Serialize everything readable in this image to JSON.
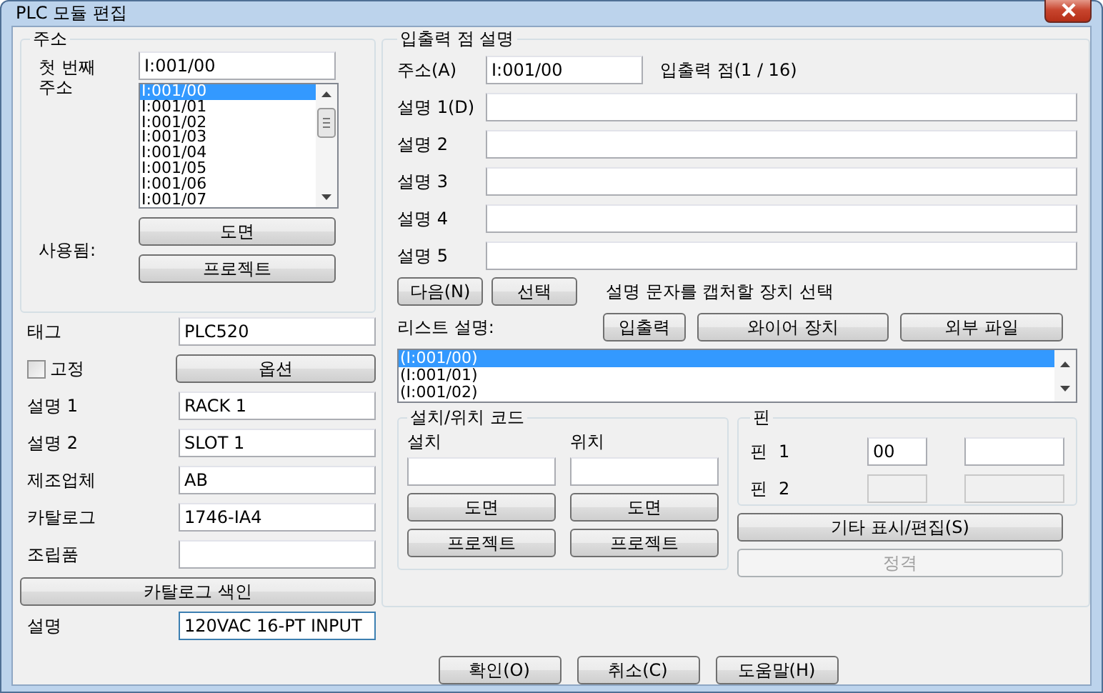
{
  "window": {
    "title": "PLC 모듈 편집"
  },
  "address_group": {
    "title": "주소",
    "first_address_label": "첫 번째 주소",
    "first_address": "I:001/00",
    "used_label": "사용됨:",
    "buttons": [
      "도면",
      "프로젝트"
    ],
    "address_list": [
      {
        "text": "I:001/00",
        "selected": true
      },
      {
        "text": "I:001/01",
        "selected": false
      },
      {
        "text": "I:001/02",
        "selected": false
      },
      {
        "text": "I:001/03",
        "selected": false
      },
      {
        "text": "I:001/04",
        "selected": false
      },
      {
        "text": "I:001/05",
        "selected": false
      },
      {
        "text": "I:001/06",
        "selected": false
      },
      {
        "text": "I:001/07",
        "selected": false
      }
    ]
  },
  "tag": {
    "label": "태그",
    "value": "PLC520"
  },
  "fixed": {
    "label": "고정",
    "checked": false
  },
  "options_button": "옵션",
  "fields": [
    {
      "label": "설명 1",
      "value": "RACK 1"
    },
    {
      "label": "설명 2",
      "value": "SLOT 1"
    },
    {
      "label": "제조업체",
      "value": "AB"
    },
    {
      "label": "카탈로그",
      "value": "1746-IA4"
    },
    {
      "label": "조립품"
    }
  ],
  "catalog_index_button": "카탈로그 색인",
  "description": {
    "label": "설명",
    "value": "120VAC 16-PT INPUT"
  },
  "io_group": {
    "title": "입출력 점 설명",
    "address_label": "주소(A)",
    "address": "I:001/00",
    "point_count": "입출력 점(1 / 16)",
    "descriptions": [
      {
        "label": "설명 1(D)"
      },
      {
        "label": "설명 2"
      },
      {
        "label": "설명 3"
      },
      {
        "label": "설명 4"
      },
      {
        "label": "설명 5"
      }
    ],
    "next_button": "다음(N)",
    "select_button": "선택",
    "select_hint": "설명 문자를 캡처할 장치 선택",
    "list_label": "리스트 설명:",
    "list_buttons": [
      "입출력",
      "와이어 장치",
      "외부 파일"
    ],
    "list_items": [
      {
        "text": "(I:001/00)",
        "selected": true
      },
      {
        "text": "(I:001/01)",
        "selected": false
      },
      {
        "text": "(I:001/02)",
        "selected": false
      }
    ],
    "location_group": {
      "title": "설치/위치 코드",
      "columns": [
        {
          "label": "설치",
          "buttons": [
            "도면",
            "프로젝트"
          ]
        },
        {
          "label": "위치",
          "buttons": [
            "도면",
            "프로젝트"
          ]
        }
      ]
    },
    "pin_group": {
      "title": "핀",
      "pins": [
        {
          "label": "핀",
          "number": "1",
          "value": "00",
          "disabled": false
        },
        {
          "label": "핀",
          "number": "2",
          "disabled": true
        }
      ]
    },
    "other_button": "기타 표시/편집(S)",
    "rating_button": {
      "label": "정격",
      "disabled": true
    }
  },
  "footer_buttons": [
    "확인(O)",
    "취소(C)",
    "도움말(H)"
  ]
}
